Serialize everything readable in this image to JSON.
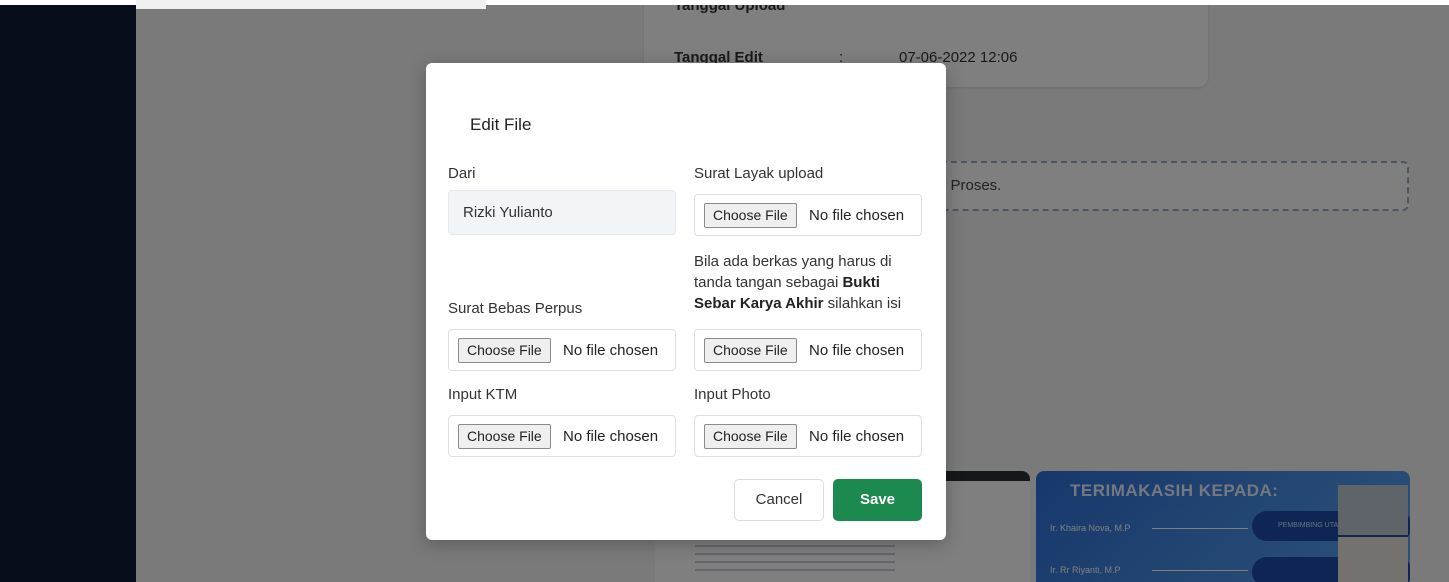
{
  "background": {
    "info_card": {
      "top_label": "Tanggal Upload",
      "edit_label": "Tanggal Edit",
      "colon": ":",
      "edit_value": "07-06-2022 12:06"
    },
    "status_text": "i Proses.",
    "slide": {
      "title": "TERIMAKASIH KEPADA:",
      "name1": "Ir. Khaira Nova, M.P",
      "name2": "Ir. Rr Riyanti, M.P",
      "pill1": "PEMBIMBING UTAMA",
      "pill2": "PEMBIMB"
    }
  },
  "modal": {
    "title": "Edit File",
    "dari": {
      "label": "Dari",
      "value": "Rizki Yulianto"
    },
    "surat_layak": {
      "label": "Surat Layak upload"
    },
    "note": {
      "part1": "Bila ada berkas yang harus di tanda tangan sebagai ",
      "bold": "Bukti Sebar Karya Akhir",
      "part2": " silahkan isi"
    },
    "surat_bebas": {
      "label": "Surat Bebas Perpus"
    },
    "ktm": {
      "label": "Input KTM"
    },
    "photo": {
      "label": "Input Photo"
    },
    "file_input": {
      "choose_label": "Choose File",
      "no_file": "No file chosen"
    },
    "cancel_label": "Cancel",
    "save_label": "Save"
  },
  "colors": {
    "sidebar": "#0e1a35",
    "save_button": "#1c8a4e",
    "overlay": "rgba(0,0,0,0.5)"
  }
}
